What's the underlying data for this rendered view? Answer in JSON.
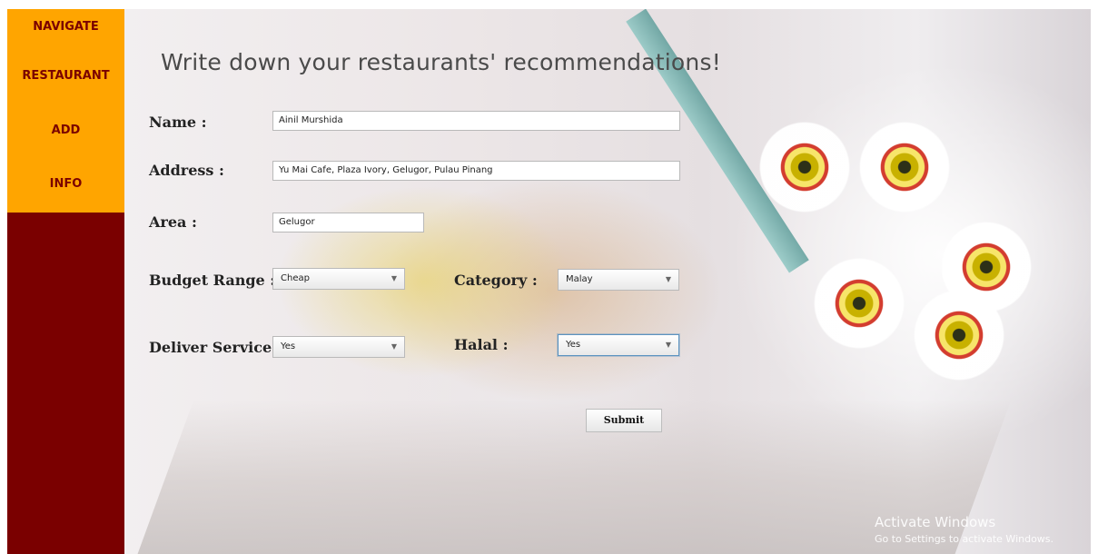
{
  "sidebar": {
    "items": [
      {
        "label": "NAVIGATE"
      },
      {
        "label": "RESTAURANT"
      },
      {
        "label": "ADD"
      },
      {
        "label": "INFO"
      }
    ]
  },
  "main": {
    "title": "Write down your restaurants' recommendations!",
    "form": {
      "name_label": "Name  :",
      "name_value": "Ainil Murshida",
      "address_label": "Address :",
      "address_value": "Yu Mai Cafe, Plaza Ivory, Gelugor, Pulau Pinang",
      "area_label": "Area :",
      "area_value": "Gelugor",
      "budget_label": "Budget Range :",
      "budget_value": "Cheap",
      "category_label": "Category :",
      "category_value": "Malay",
      "deliver_label": "Deliver Service :",
      "deliver_value": "Yes",
      "halal_label": "Halal :",
      "halal_value": "Yes",
      "submit_label": "Submit"
    }
  },
  "watermark": {
    "line1": "Activate Windows",
    "line2": "Go to Settings to activate Windows."
  },
  "colors": {
    "sidebar_nav": "#ffa500",
    "sidebar_bg": "#7a0000"
  }
}
